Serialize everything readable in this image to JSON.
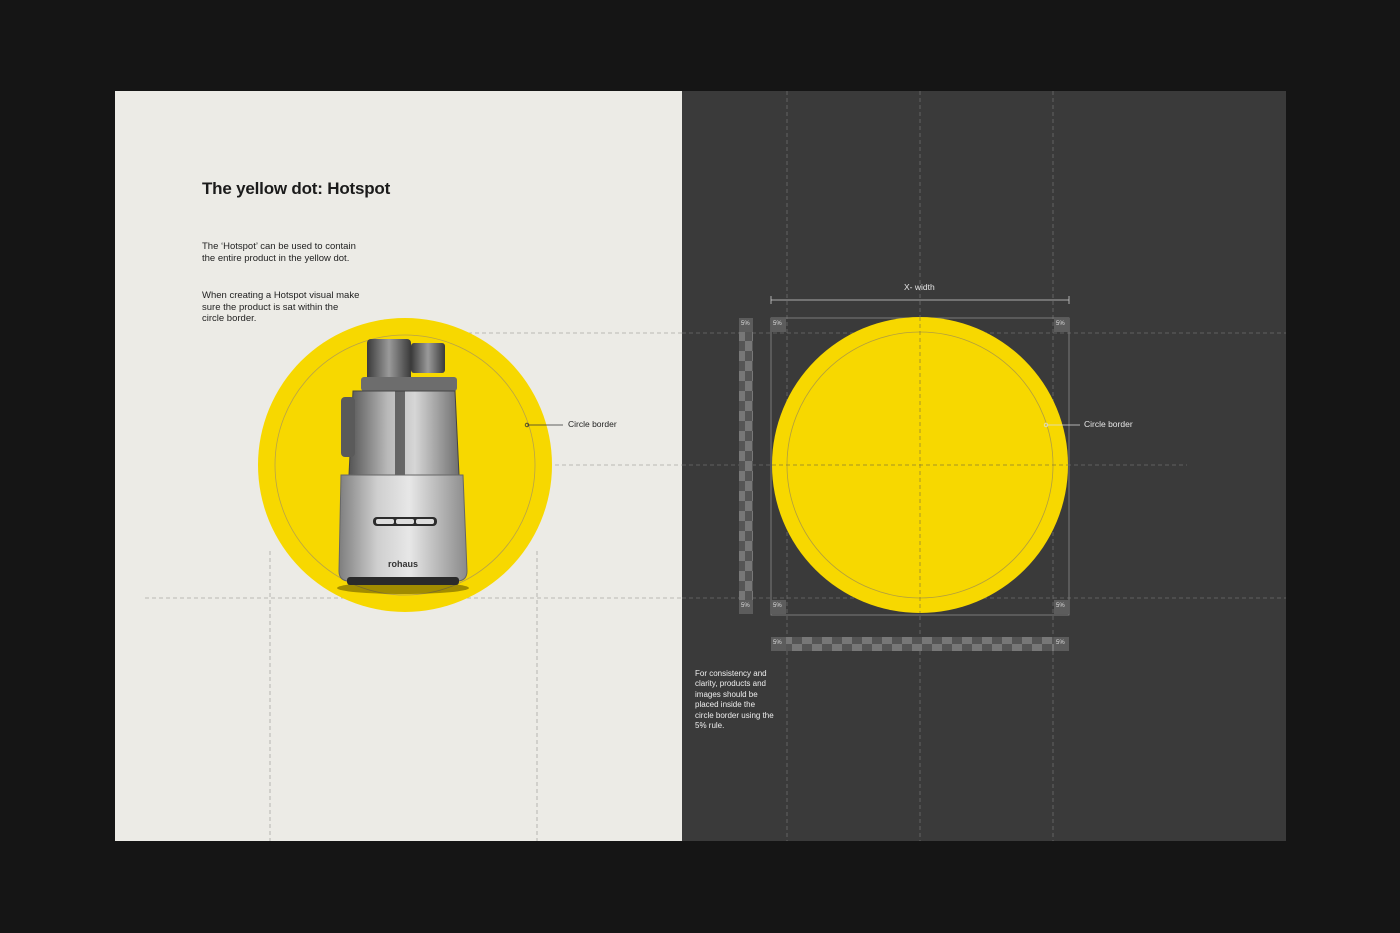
{
  "title": "The yellow dot: Hotspot",
  "paragraphs": [
    "The ‘Hotspot’ can be used to contain the entire product in the yellow dot.",
    "When creating a Hotspot visual make sure the product is sat within the circle border."
  ],
  "left_callout": "Circle border",
  "right_callout": "Circle border",
  "width_label": "X- width",
  "margin_label": "5%",
  "note": "For consistency and clarity, products and images should be placed inside the circle border using the 5% rule.",
  "product_brand": "rohaus",
  "colors": {
    "yellow": "#f7d800",
    "paper": "#ecebe6",
    "dark_page": "#3a3a3a"
  }
}
